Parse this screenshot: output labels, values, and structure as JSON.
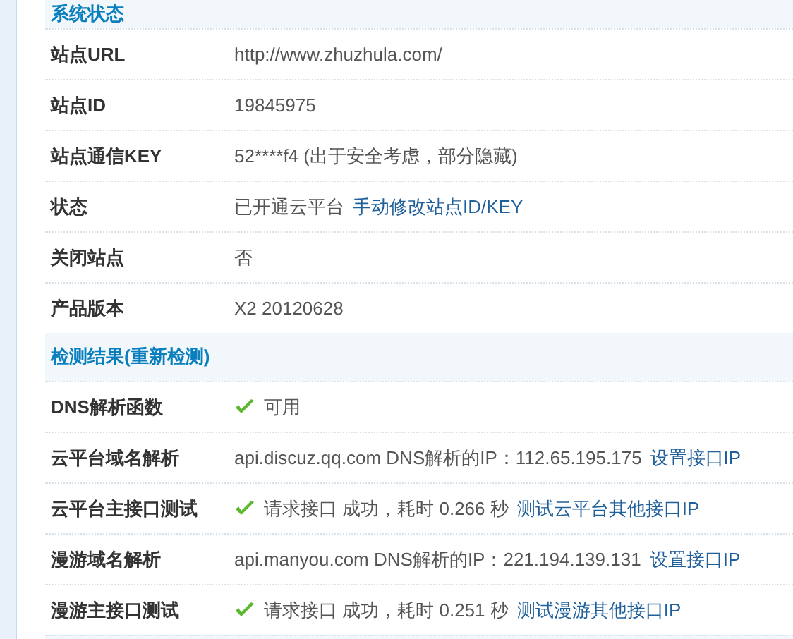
{
  "sections": [
    {
      "title": "系统状态",
      "rows": [
        {
          "label": "站点URL",
          "value": "http://www.zhuzhula.com/",
          "ok": false
        },
        {
          "label": "站点ID",
          "value": "19845975",
          "ok": false
        },
        {
          "label": "站点通信KEY",
          "value": "52****f4 (出于安全考虑，部分隐藏)",
          "ok": false
        },
        {
          "label": "状态",
          "value": "已开通云平台",
          "link": "手动修改站点ID/KEY",
          "ok": false
        },
        {
          "label": "关闭站点",
          "value": "否",
          "ok": false
        },
        {
          "label": "产品版本",
          "value": "X2 20120628",
          "ok": false
        }
      ]
    },
    {
      "title": "检测结果(重新检测)",
      "rows": [
        {
          "label": "DNS解析函数",
          "value": "可用",
          "ok": true
        },
        {
          "label": "云平台域名解析",
          "value": "api.discuz.qq.com DNS解析的IP：112.65.195.175",
          "link": "设置接口IP",
          "ok": false
        },
        {
          "label": "云平台主接口测试",
          "value": "请求接口 成功，耗时 0.266 秒",
          "link": "测试云平台其他接口IP",
          "ok": true
        },
        {
          "label": "漫游域名解析",
          "value": "api.manyou.com DNS解析的IP：221.194.139.131",
          "link": "设置接口IP",
          "ok": false
        },
        {
          "label": "漫游主接口测试",
          "value": "请求接口 成功，耗时 0.251 秒",
          "link": "测试漫游其他接口IP",
          "ok": true
        }
      ]
    }
  ]
}
